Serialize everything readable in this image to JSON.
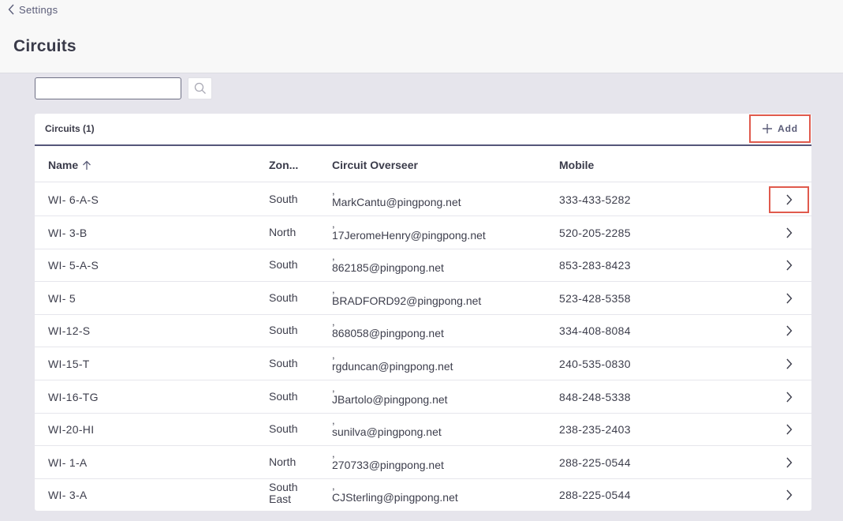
{
  "breadcrumb": {
    "back_label": "Settings"
  },
  "page": {
    "title": "Circuits"
  },
  "search": {
    "value": "",
    "placeholder": ""
  },
  "card": {
    "title": "Circuits (1)",
    "add_label": "Add"
  },
  "table": {
    "columns": {
      "name": "Name",
      "zone": "Zon...",
      "overseer": "Circuit Overseer",
      "mobile": "Mobile"
    },
    "sort_column": "name",
    "sort_direction": "ascending",
    "rows": [
      {
        "name": "WI- 6-A-S",
        "zone": "South",
        "overseer_prefix": ",",
        "overseer_email": "MarkCantu@pingpong.net",
        "mobile": "333-433-5282",
        "highlighted": true
      },
      {
        "name": "WI- 3-B",
        "zone": "North",
        "overseer_prefix": ",",
        "overseer_email": "17JeromeHenry@pingpong.net",
        "mobile": "520-205-2285"
      },
      {
        "name": "WI- 5-A-S",
        "zone": "South",
        "overseer_prefix": ",",
        "overseer_email": "862185@pingpong.net",
        "mobile": "853-283-8423"
      },
      {
        "name": "WI- 5",
        "zone": "South",
        "overseer_prefix": ",",
        "overseer_email": "BRADFORD92@pingpong.net",
        "mobile": "523-428-5358"
      },
      {
        "name": "WI-12-S",
        "zone": "South",
        "overseer_prefix": ",",
        "overseer_email": "868058@pingpong.net",
        "mobile": "334-408-8084"
      },
      {
        "name": "WI-15-T",
        "zone": "South",
        "overseer_prefix": ",",
        "overseer_email": "rgduncan@pingpong.net",
        "mobile": "240-535-0830"
      },
      {
        "name": "WI-16-TG",
        "zone": "South",
        "overseer_prefix": ",",
        "overseer_email": "JBartolo@pingpong.net",
        "mobile": "848-248-5338"
      },
      {
        "name": "WI-20-HI",
        "zone": "South",
        "overseer_prefix": ",",
        "overseer_email": "sunilva@pingpong.net",
        "mobile": "238-235-2403"
      },
      {
        "name": "WI- 1-A",
        "zone": "North",
        "overseer_prefix": ",",
        "overseer_email": "270733@pingpong.net",
        "mobile": "288-225-0544"
      },
      {
        "name": "WI- 3-A",
        "zone": "South East",
        "zone_lines": [
          "South",
          "East"
        ],
        "overseer_prefix": ",",
        "overseer_email": "CJSterling@pingpong.net",
        "mobile": "288-225-0544"
      }
    ]
  },
  "icons": {
    "back": "chevron-left-icon",
    "search": "search-icon",
    "add": "plus-icon",
    "sort": "arrow-up-icon",
    "row_open": "chevron-right-icon"
  },
  "colors": {
    "highlight_border": "#e05a4d",
    "header_rule": "#55567a",
    "background": "#e6e5ec"
  }
}
